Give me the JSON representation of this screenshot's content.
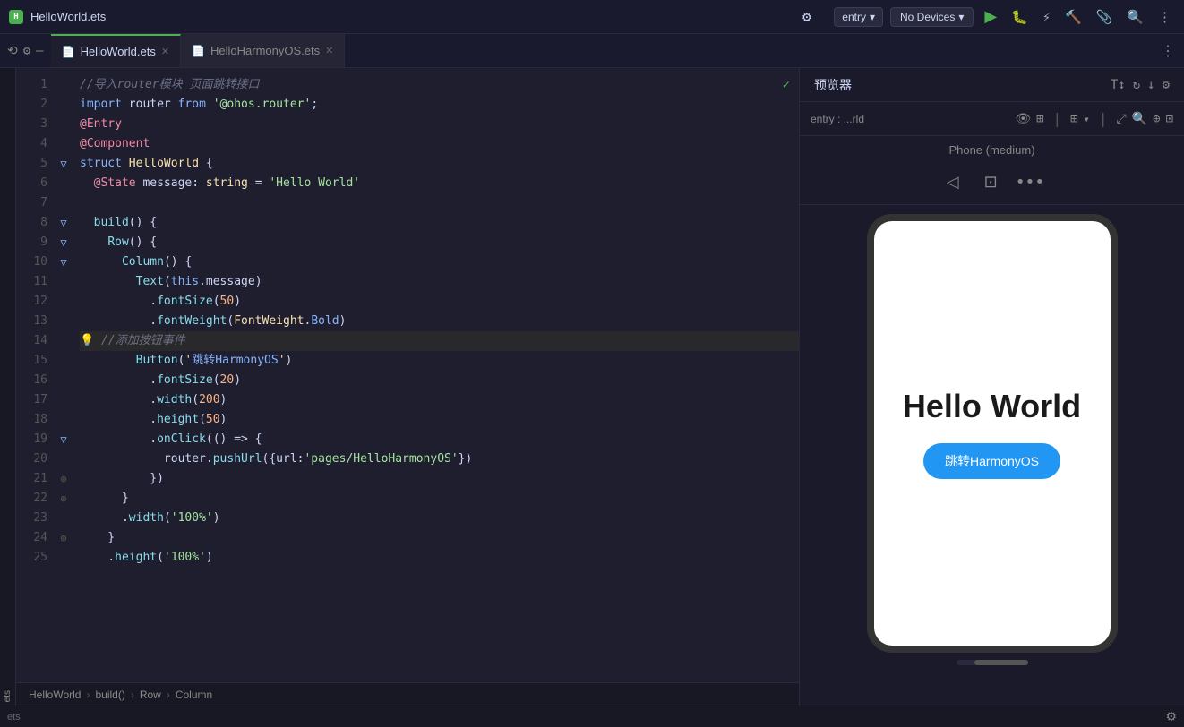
{
  "titleBar": {
    "projectName": "HelloWorld.ets",
    "entryLabel": "entry",
    "noDevicesLabel": "No Devices",
    "runIcon": "▶",
    "bugIcon": "🐛",
    "profileIcon": "⚡",
    "buildIcon": "🔧",
    "searchIcon": "🔍",
    "gearIcon": "⚙"
  },
  "tabs": {
    "tab1": {
      "label": "HelloWorld.ets",
      "active": true
    },
    "tab2": {
      "label": "HelloHarmonyOS.ets",
      "active": false
    }
  },
  "tabBar": {
    "moreIcon": "⋮",
    "leftIcon1": "⟲",
    "leftIcon2": "⚙",
    "leftIcon3": "—"
  },
  "editor": {
    "lines": [
      {
        "num": 1,
        "hasFold": false,
        "hasSideIcon": false,
        "content": "comment_router"
      },
      {
        "num": 2,
        "hasFold": false,
        "hasSideIcon": false,
        "content": "import_router"
      },
      {
        "num": 3,
        "hasFold": false,
        "hasSideIcon": false,
        "content": "at_entry"
      },
      {
        "num": 4,
        "hasFold": false,
        "hasSideIcon": false,
        "content": "at_component"
      },
      {
        "num": 5,
        "hasFold": true,
        "hasSideIcon": false,
        "content": "struct_helloworld"
      },
      {
        "num": 6,
        "hasFold": false,
        "hasSideIcon": false,
        "content": "state_message"
      },
      {
        "num": 7,
        "hasFold": false,
        "hasSideIcon": false,
        "content": "empty"
      },
      {
        "num": 8,
        "hasFold": true,
        "hasSideIcon": false,
        "content": "build"
      },
      {
        "num": 9,
        "hasFold": true,
        "hasSideIcon": false,
        "content": "row"
      },
      {
        "num": 10,
        "hasFold": true,
        "hasSideIcon": false,
        "content": "column"
      },
      {
        "num": 11,
        "hasFold": false,
        "hasSideIcon": false,
        "content": "text_message"
      },
      {
        "num": 12,
        "hasFold": false,
        "hasSideIcon": false,
        "content": "font_size"
      },
      {
        "num": 13,
        "hasFold": false,
        "hasSideIcon": false,
        "content": "font_weight"
      },
      {
        "num": 14,
        "hasFold": false,
        "hasSideIcon": true,
        "content": "comment_add_btn",
        "hint": "💡"
      },
      {
        "num": 15,
        "hasFold": false,
        "hasSideIcon": false,
        "content": "button_jump"
      },
      {
        "num": 16,
        "hasFold": false,
        "hasSideIcon": false,
        "content": "btn_font_size"
      },
      {
        "num": 17,
        "hasFold": false,
        "hasSideIcon": false,
        "content": "btn_width"
      },
      {
        "num": 18,
        "hasFold": false,
        "hasSideIcon": false,
        "content": "btn_height"
      },
      {
        "num": 19,
        "hasFold": true,
        "hasSideIcon": false,
        "content": "on_click"
      },
      {
        "num": 20,
        "hasFold": false,
        "hasSideIcon": false,
        "content": "router_push"
      },
      {
        "num": 21,
        "hasFold": false,
        "hasSideIcon": false,
        "content": "close_brace_1"
      },
      {
        "num": 22,
        "hasFold": false,
        "hasSideIcon": false,
        "content": "close_brace_2"
      },
      {
        "num": 23,
        "hasFold": false,
        "hasSideIcon": false,
        "content": "col_width"
      },
      {
        "num": 24,
        "hasFold": false,
        "hasSideIcon": false,
        "content": "close_brace_3"
      },
      {
        "num": 25,
        "hasFold": false,
        "hasSideIcon": false,
        "content": "height_partial"
      }
    ],
    "checkmarkLine": 1
  },
  "breadcrumb": {
    "items": [
      "HelloWorld",
      "build()",
      "Row",
      "Column"
    ],
    "separators": [
      ">",
      ">",
      ">"
    ]
  },
  "preview": {
    "title": "预览器",
    "entryLabel": "entry : ...rld",
    "deviceLabel": "Phone (medium)",
    "helloText": "Hello World",
    "buttonText": "跳转HarmonyOS",
    "headerIcons": [
      "T↕",
      "↻",
      "↓",
      "⚙"
    ],
    "toolbarIcons": [
      "⊞",
      "▾"
    ],
    "ctrlIcons": [
      "◁",
      "⊡",
      "•••"
    ]
  },
  "statusBar": {
    "leftText": "ets",
    "gearLabel": "⚙"
  }
}
